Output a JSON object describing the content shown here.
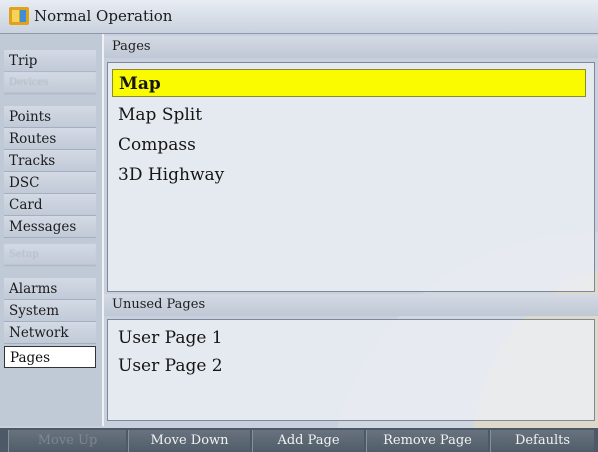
{
  "title_bar": {
    "title": "Normal Operation",
    "icon": "garmin-flag-icon"
  },
  "sidebar": {
    "items": [
      {
        "label": "Trip",
        "state": "normal"
      },
      {
        "label": "Devices",
        "state": "blurred"
      },
      {
        "label": "Points",
        "state": "normal"
      },
      {
        "label": "Routes",
        "state": "normal"
      },
      {
        "label": "Tracks",
        "state": "normal"
      },
      {
        "label": "DSC",
        "state": "normal"
      },
      {
        "label": "Card",
        "state": "normal"
      },
      {
        "label": "Messages",
        "state": "normal"
      },
      {
        "label": "Setup",
        "state": "blurred"
      },
      {
        "label": "Alarms",
        "state": "normal"
      },
      {
        "label": "System",
        "state": "normal"
      },
      {
        "label": "Network",
        "state": "normal"
      },
      {
        "label": "Pages",
        "state": "active"
      }
    ]
  },
  "pages_panel": {
    "header": "Pages",
    "items": [
      "Map",
      "Map Split",
      "Compass",
      "3D Highway"
    ],
    "selected_index": 0
  },
  "unused_panel": {
    "header": "Unused Pages",
    "items": [
      "User Page 1",
      "User Page 2"
    ]
  },
  "softkeys": [
    {
      "label": "Move Up",
      "enabled": false
    },
    {
      "label": "Move Down",
      "enabled": true
    },
    {
      "label": "Add Page",
      "enabled": true
    },
    {
      "label": "Remove Page",
      "enabled": true
    },
    {
      "label": "Defaults",
      "enabled": true
    }
  ],
  "colors": {
    "selection": "#fbfb00",
    "softkey_bar": "#4d5966",
    "panel_bg": "#c7d0dc",
    "watermark_gear": "#d6dbe3",
    "watermark_accent": "#e9d9b8"
  }
}
